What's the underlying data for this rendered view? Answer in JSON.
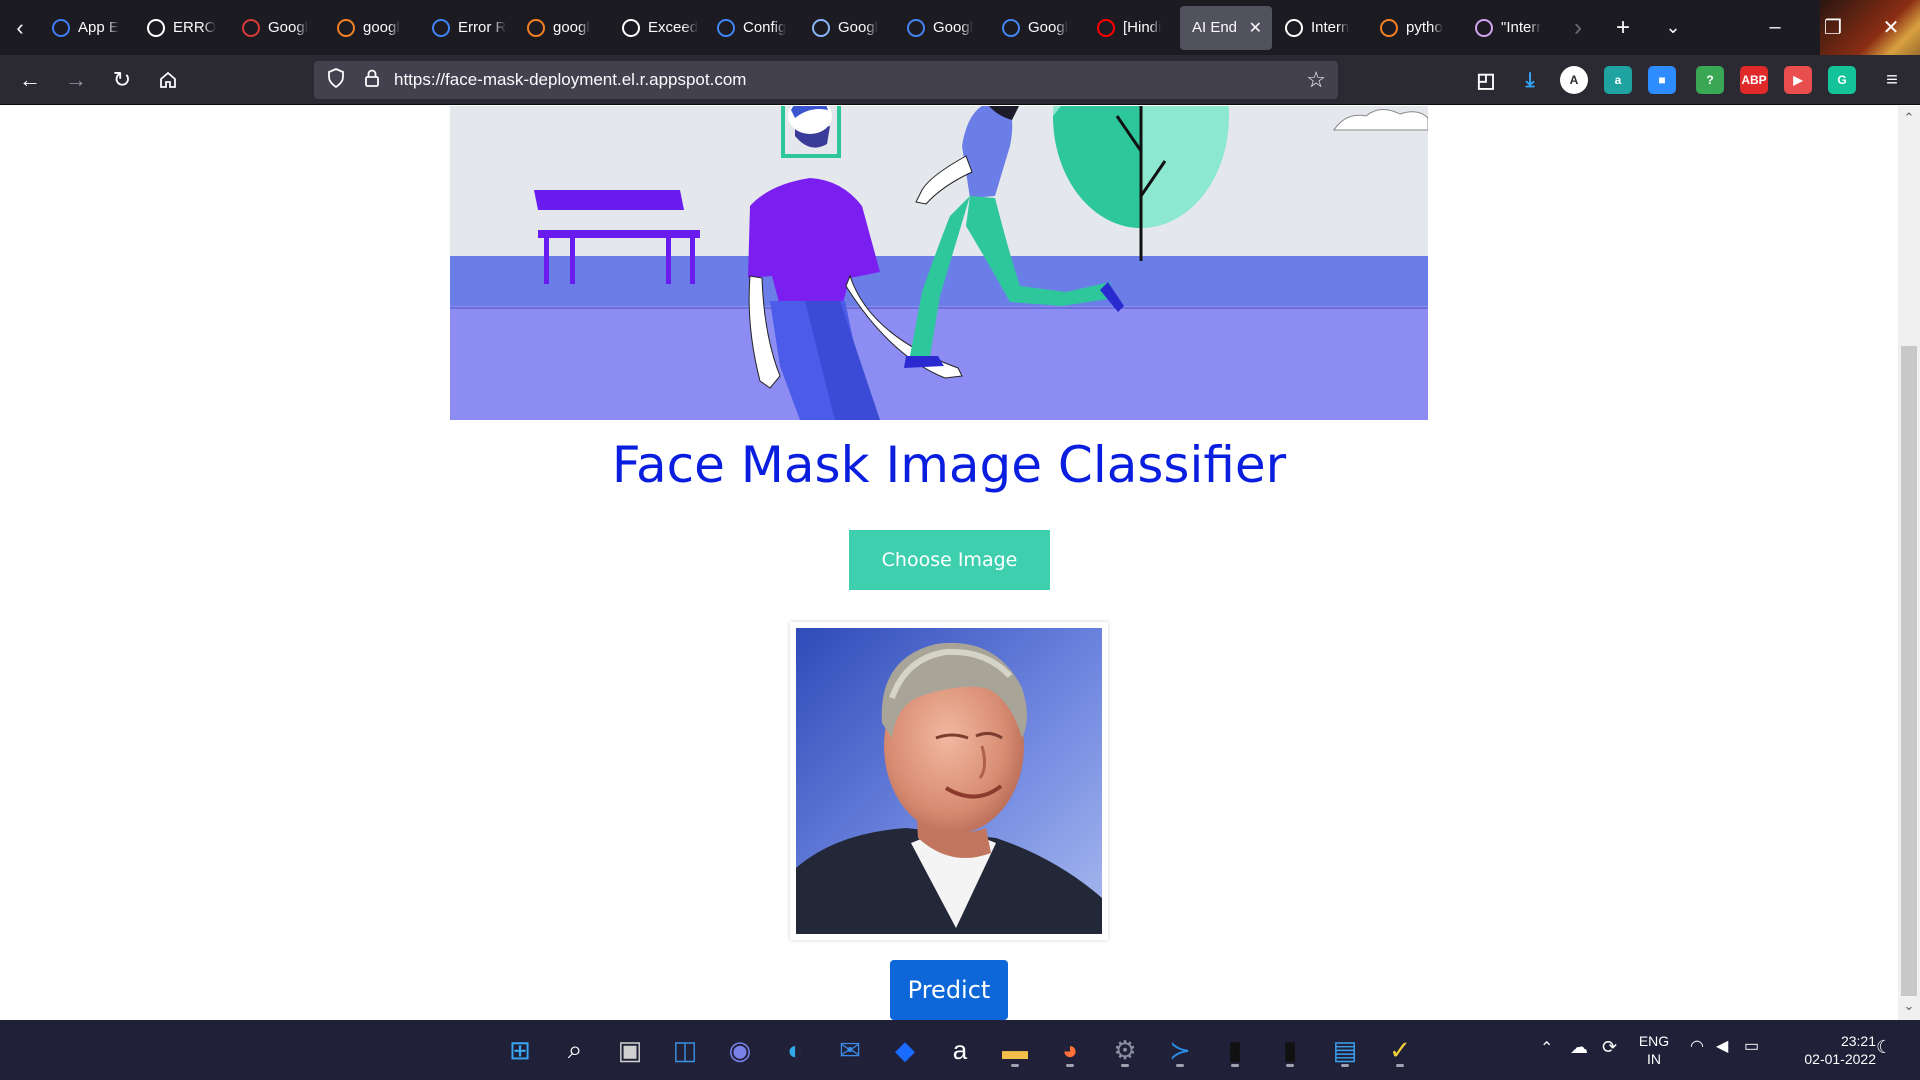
{
  "browser": {
    "tabs": [
      {
        "label": "App E",
        "icon": "people-icon",
        "color": "#3d7cf2"
      },
      {
        "label": "ERRO",
        "icon": "github-icon",
        "color": "#ffffff"
      },
      {
        "label": "Googl",
        "icon": "grid-icon",
        "color": "#d63a3a"
      },
      {
        "label": "googl",
        "icon": "stackoverflow-icon",
        "color": "#f48024"
      },
      {
        "label": "Error R",
        "icon": "gcloud-icon",
        "color": "#4285f4"
      },
      {
        "label": "googl",
        "icon": "stackoverflow-icon",
        "color": "#f48024"
      },
      {
        "label": "Exceed",
        "icon": "google-icon",
        "color": "#ffffff"
      },
      {
        "label": "Config",
        "icon": "gcloud-icon",
        "color": "#4285f4"
      },
      {
        "label": "Googl",
        "icon": "chat-icon",
        "color": "#8ab4f8"
      },
      {
        "label": "Googl",
        "icon": "search-person-icon",
        "color": "#4285f4"
      },
      {
        "label": "Googl",
        "icon": "gcloud-icon",
        "color": "#4285f4"
      },
      {
        "label": "[Hindi",
        "icon": "youtube-icon",
        "color": "#ff0000"
      },
      {
        "label": "AI End",
        "icon": "",
        "color": "",
        "active": true
      },
      {
        "label": "Intern",
        "icon": "google-icon",
        "color": "#ffffff"
      },
      {
        "label": "pytho",
        "icon": "stackoverflow-icon",
        "color": "#f48024"
      },
      {
        "label": "\"Interr",
        "icon": "opera-icon",
        "color": "#d4a4f0"
      }
    ],
    "url": "https://face-mask-deployment.el.r.appspot.com",
    "extensions": [
      {
        "name": "pocket-icon",
        "glyph": "◰",
        "bg": "transparent"
      },
      {
        "name": "download-icon",
        "glyph": "⤓",
        "bg": "transparent"
      },
      {
        "name": "account-a-icon",
        "glyph": "A",
        "bg": "#ffffff"
      },
      {
        "name": "amazon-assistant-icon",
        "glyph": "a",
        "bg": "#1fa3a0"
      },
      {
        "name": "zoom-icon",
        "glyph": "■",
        "bg": "#2d8cff"
      },
      {
        "name": "notification-ext-icon",
        "glyph": "?",
        "bg": "#3aa755"
      },
      {
        "name": "adblock-plus-icon",
        "glyph": "ABP",
        "bg": "#e02a2a"
      },
      {
        "name": "video-ext-icon",
        "glyph": "▶",
        "bg": "#e94d4d"
      },
      {
        "name": "grammarly-icon",
        "glyph": "G",
        "bg": "#15c39a"
      }
    ]
  },
  "page": {
    "title": "Face Mask Image Classifier",
    "choose_button": "Choose Image",
    "predict_button": "Predict"
  },
  "taskbar": {
    "apps": [
      "windows-start-icon",
      "search-icon",
      "task-view-icon",
      "widgets-icon",
      "teams-chat-icon",
      "edge-icon",
      "mail-icon",
      "dropbox-icon",
      "amazon-icon",
      "file-explorer-icon",
      "firefox-icon",
      "settings-icon",
      "vscode-icon",
      "terminal-icon",
      "terminal-icon",
      "notepad-icon",
      "norton-icon"
    ],
    "language": "ENG",
    "region": "IN",
    "time": "23:21",
    "date": "02-01-2022"
  }
}
